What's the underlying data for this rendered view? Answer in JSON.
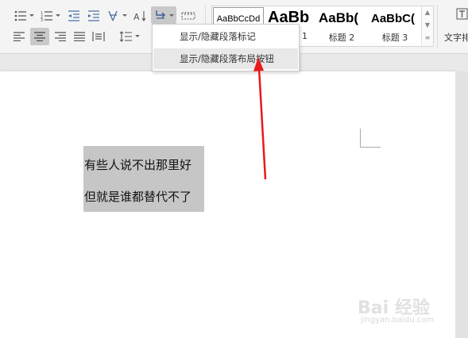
{
  "ribbon": {
    "styles": [
      {
        "sample": "AaBbCcDd",
        "name": ""
      },
      {
        "sample": "AaBb",
        "name": "1"
      },
      {
        "sample": "AaBb(",
        "name": "标题 2"
      },
      {
        "sample": "AaBbC(",
        "name": "标题 3"
      }
    ],
    "textbox_label": "文字排"
  },
  "dropdown": {
    "items": [
      {
        "label": "显示/隐藏段落标记"
      },
      {
        "label": "显示/隐藏段落布局按钮"
      }
    ]
  },
  "document": {
    "lines": [
      "有些人说不出那里好",
      "但就是谁都替代不了"
    ]
  },
  "watermark": {
    "brand": "Bai 经验",
    "url": "jingyan.baidu.com"
  },
  "colors": {
    "arrow": "#e8191d",
    "selection": "#c6c6c6",
    "active_button": "#c9c9c9"
  }
}
